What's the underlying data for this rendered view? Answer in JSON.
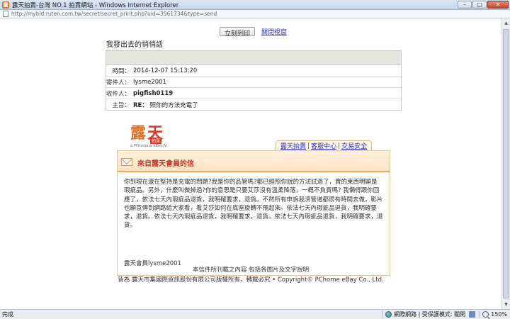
{
  "window": {
    "title": "露天拍賣-台灣 NO.1 拍賣網站 - Windows Internet Explorer",
    "url": "http://mybid.ruten.com.tw/secret/secret_print.php?uid=3561734&type=send",
    "controls": {
      "minimize": "–",
      "maximize": "□",
      "close": "✕"
    }
  },
  "toolbar": {
    "print_label": "立刻列印",
    "close_label": "關閉視窗"
  },
  "message": {
    "heading": "我發出去的悄悄話",
    "rows": [
      {
        "label": "時間：",
        "value": "2014-12-07 15:13:20",
        "bold": false
      },
      {
        "label": "寄件人：",
        "value": "lysme2001",
        "bold": false
      },
      {
        "label": "收件人：",
        "value": "pigfish0119",
        "bold": true
      },
      {
        "label": "主旨：",
        "prefix": "RE：",
        "value": "照你的方法充電了",
        "bold": false
      }
    ]
  },
  "logo": {
    "char1": "露",
    "char2": "天",
    "badge": "拍賣",
    "tagline": "a PChome & eBay JV"
  },
  "tabs": [
    "露天拍賣",
    "客服中心",
    "交易安全"
  ],
  "tab_separator": "|",
  "letter": {
    "title": "來自露天會員的信",
    "body": "你到現在還在堅持是充電的問題?我是你的品管嗎?都已經照你說的方法試過了，賣的東西明顯是瑕疵品。另外，什麼叫做掉過?你的意思是只要艾莎沒有溫柔降落，一概不負責嗎? 我懶得跟你回應了，依法七天內瑕疵品退貨，我明確要求，退貨。不然所有申訴我濟管道都很有時間去做，影片也願意傳到網路給大家看，看艾莎如何在底座旋轉不飛起來。依法七天內瑕疵品退貨，我明確要求，退貨。依法七天內瑕疵品退貨，我明確要求，退貨。依法七天內瑕疵品退貨，我明確要求，退貨。",
    "signature": "露天會員lysme2001"
  },
  "footer": {
    "line1": "本信件所刊載之內容 包括各圖片及文字說明",
    "line2": "皆為 露天市集國際資訊股份有限公司版權所有，轉載必究 • Copyright©    PChome eBay Co., Ltd."
  },
  "statusbar": {
    "left": "完成",
    "zone": "網際網路 | 受保護模式: 關閉",
    "zoom": "150%"
  },
  "colors": {
    "accent": "#f2a65c",
    "link": "#2233cc",
    "title_red": "#c0392b",
    "logo_orange": "#e0702a",
    "logo_red": "#d93a26"
  }
}
